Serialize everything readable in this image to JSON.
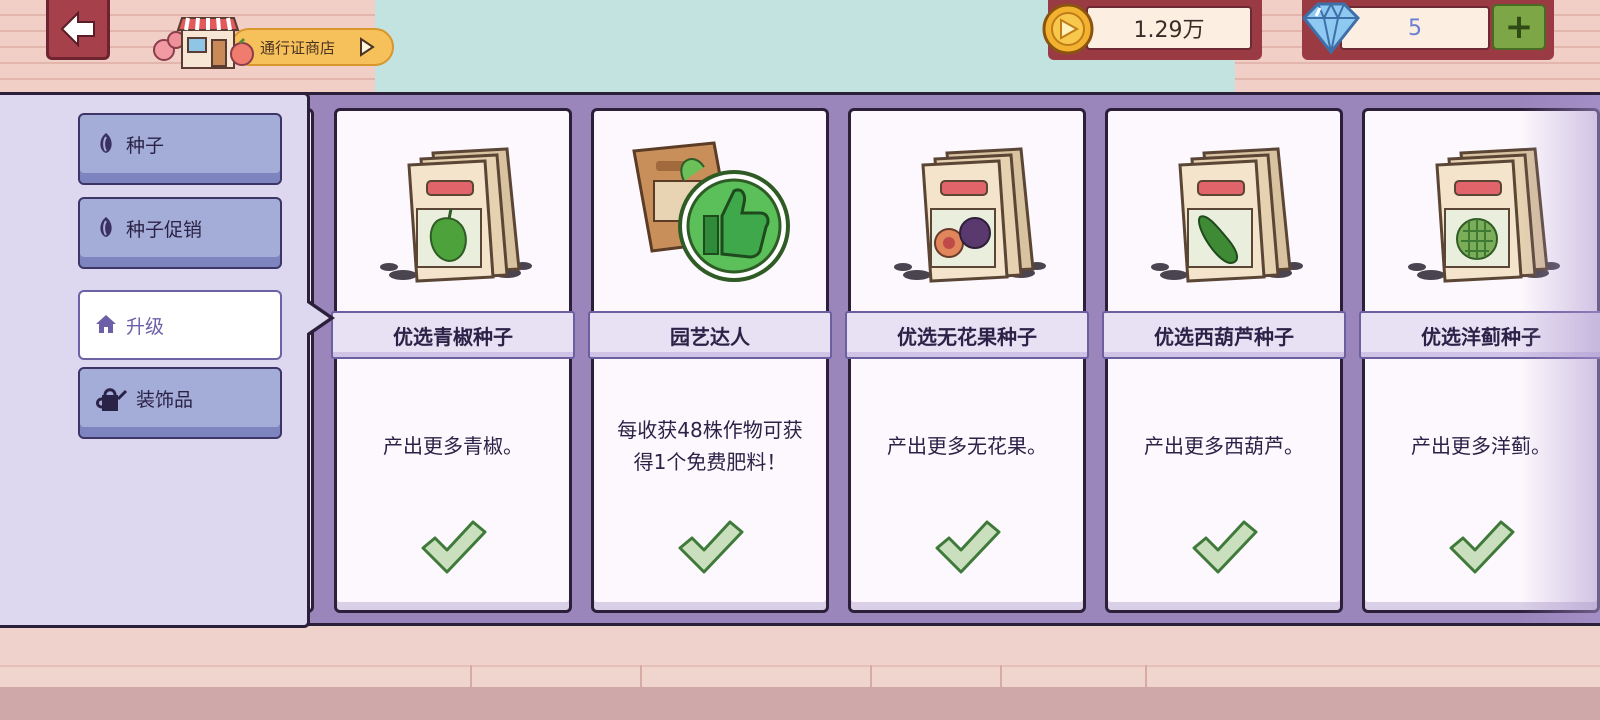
{
  "header": {
    "pass_shop_label": "通行证商店",
    "coins": "1.29万",
    "gems": "5",
    "add_label": "+"
  },
  "sidebar": {
    "tabs": [
      {
        "label": "种子",
        "icon": "seed-icon",
        "active": false
      },
      {
        "label": "种子促销",
        "icon": "seed-icon",
        "active": false
      },
      {
        "label": "升级",
        "icon": "house-icon",
        "active": true
      },
      {
        "label": "装饰品",
        "icon": "watering-can-icon",
        "active": false
      }
    ]
  },
  "upgrades": [
    {
      "name": "优选青椒种子",
      "desc": "产出更多青椒。",
      "crop": "pepper",
      "owned": true
    },
    {
      "name": "园艺达人",
      "desc": "每收获48株作物可获得1个免费肥料！",
      "crop": "thumbs-up",
      "owned": true
    },
    {
      "name": "优选无花果种子",
      "desc": "产出更多无花果。",
      "crop": "fig",
      "owned": true
    },
    {
      "name": "优选西葫芦种子",
      "desc": "产出更多西葫芦。",
      "crop": "zucchini",
      "owned": true
    },
    {
      "name": "优选洋蓟种子",
      "desc": "产出更多洋蓟。",
      "crop": "artichoke",
      "owned": true
    }
  ],
  "colors": {
    "panel": "#9b86bc",
    "sidebar": "#ddd8f0",
    "tab": "#a4acd8",
    "header_box": "#9a3b44",
    "plus_button": "#7da746",
    "check": "#c9dfbd"
  }
}
